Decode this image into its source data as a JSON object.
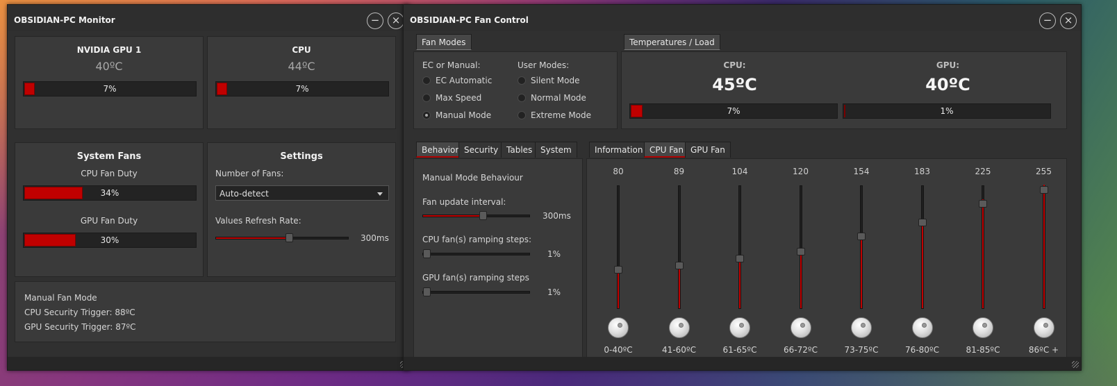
{
  "monitor": {
    "title": "OBSIDIAN-PC Monitor",
    "gpu": {
      "title": "NVIDIA GPU 1",
      "temp": "40ºC",
      "load_label": "7%",
      "load": 0.07
    },
    "cpu": {
      "title": "CPU",
      "temp": "44ºC",
      "load_label": "7%",
      "load": 0.07
    },
    "fans": {
      "title": "System Fans",
      "cpu_label": "CPU Fan Duty",
      "cpu_duty_label": "34%",
      "cpu_duty": 0.34,
      "gpu_label": "GPU Fan Duty",
      "gpu_duty_label": "30%",
      "gpu_duty": 0.3
    },
    "settings": {
      "title": "Settings",
      "num_fans_label": "Number of Fans:",
      "num_fans_value": "Auto-detect",
      "refresh_label": "Values Refresh Rate:",
      "refresh_value": "300ms",
      "refresh_level": 0.55
    },
    "info": {
      "mode": "Manual Fan Mode",
      "cpu_trigger": "CPU Security Trigger: 88ºC",
      "gpu_trigger": "GPU Security Trigger: 87ºC"
    }
  },
  "fancontrol": {
    "title": "OBSIDIAN-PC Fan Control",
    "fan_modes_tab": "Fan Modes",
    "ec_header": "EC or Manual:",
    "user_header": "User Modes:",
    "ec_modes": [
      "EC Automatic",
      "Max Speed",
      "Manual Mode"
    ],
    "user_modes": [
      "Silent Mode",
      "Normal Mode",
      "Extreme Mode"
    ],
    "selected_ec_mode": "Manual Mode",
    "temps_tab": "Temperatures / Load",
    "cpu_label": "CPU:",
    "cpu_temp": "45ºC",
    "cpu_load_label": "7%",
    "cpu_load": 0.07,
    "gpu_label": "GPU:",
    "gpu_temp": "40ºC",
    "gpu_load_label": "1%",
    "gpu_load": 0.01,
    "left_tabs": [
      "Behavior",
      "Security",
      "Tables",
      "System"
    ],
    "left_active": "Behavior",
    "behaviour": {
      "header": "Manual Mode Behaviour",
      "update_label": "Fan update interval:",
      "update_value": "300ms",
      "update_level": 0.56,
      "cpu_ramp_label": "CPU fan(s) ramping steps:",
      "cpu_ramp_value": "1%",
      "cpu_ramp_level": 0.01,
      "gpu_ramp_label": "GPU fan(s) ramping steps",
      "gpu_ramp_value": "1%",
      "gpu_ramp_level": 0.01
    },
    "right_tabs": [
      "Information",
      "CPU Fan",
      "GPU Fan"
    ],
    "right_active": "CPU Fan",
    "curve": [
      {
        "value": "80",
        "range": "0-40ºC",
        "level": 0.31
      },
      {
        "value": "89",
        "range": "41-60ºC",
        "level": 0.35
      },
      {
        "value": "104",
        "range": "61-65ºC",
        "level": 0.41
      },
      {
        "value": "120",
        "range": "66-72ºC",
        "level": 0.47
      },
      {
        "value": "154",
        "range": "73-75ºC",
        "level": 0.6
      },
      {
        "value": "183",
        "range": "76-80ºC",
        "level": 0.72
      },
      {
        "value": "225",
        "range": "81-85ºC",
        "level": 0.88
      },
      {
        "value": "255",
        "range": "86ºC +",
        "level": 1.0
      }
    ]
  },
  "icons": {
    "minimize": "minimize-icon",
    "close": "close-icon"
  },
  "colors": {
    "accent": "#c00000",
    "window": "#303030",
    "panel": "#3a3a3a"
  }
}
